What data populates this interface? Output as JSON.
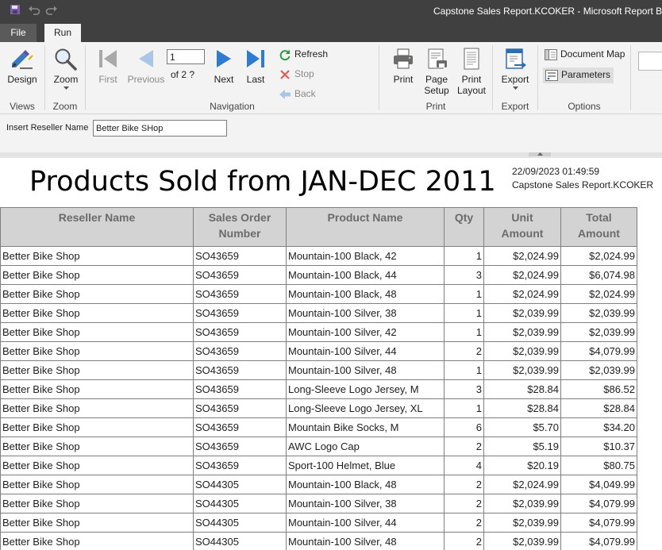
{
  "window": {
    "title": "Capstone Sales Report.KCOKER - Microsoft Report Builde"
  },
  "quick_access": [
    "save-icon",
    "undo-icon",
    "redo-icon"
  ],
  "tabs": {
    "file": "File",
    "run": "Run"
  },
  "ribbon": {
    "views": {
      "label": "Views",
      "design": "Design"
    },
    "zoom": {
      "label": "Zoom",
      "zoom": "Zoom"
    },
    "navigation": {
      "label": "Navigation",
      "first": "First",
      "previous": "Previous",
      "next": "Next",
      "last": "Last",
      "page_current": "1",
      "page_of": "of  2 ?",
      "refresh": "Refresh",
      "stop": "Stop",
      "back": "Back"
    },
    "print": {
      "label": "Print",
      "print": "Print",
      "page_setup_1": "Page",
      "page_setup_2": "Setup",
      "print_layout_1": "Print",
      "print_layout_2": "Layout"
    },
    "export": {
      "label": "Export",
      "export": "Export"
    },
    "options": {
      "label": "Options",
      "document_map": "Document Map",
      "parameters": "Parameters"
    }
  },
  "parameter": {
    "label": "Insert Reseller Name",
    "value": "Better Bike SHop"
  },
  "report": {
    "title": "Products Sold from JAN-DEC 2011",
    "run_date": "22/09/2023 01:49:59",
    "report_name": "Capstone Sales Report.KCOKER",
    "columns": [
      {
        "l1": "Reseller Name",
        "l2": ""
      },
      {
        "l1": "Sales Order",
        "l2": "Number"
      },
      {
        "l1": "Product Name",
        "l2": ""
      },
      {
        "l1": "Qty",
        "l2": ""
      },
      {
        "l1": "Unit",
        "l2": "Amount"
      },
      {
        "l1": "Total",
        "l2": "Amount"
      }
    ],
    "rows": [
      [
        "Better Bike Shop",
        "SO43659",
        "Mountain-100 Black, 42",
        "1",
        "$2,024.99",
        "$2,024.99"
      ],
      [
        "Better Bike Shop",
        "SO43659",
        "Mountain-100 Black, 44",
        "3",
        "$2,024.99",
        "$6,074.98"
      ],
      [
        "Better Bike Shop",
        "SO43659",
        "Mountain-100 Black, 48",
        "1",
        "$2,024.99",
        "$2,024.99"
      ],
      [
        "Better Bike Shop",
        "SO43659",
        "Mountain-100 Silver, 38",
        "1",
        "$2,039.99",
        "$2,039.99"
      ],
      [
        "Better Bike Shop",
        "SO43659",
        "Mountain-100 Silver, 42",
        "1",
        "$2,039.99",
        "$2,039.99"
      ],
      [
        "Better Bike Shop",
        "SO43659",
        "Mountain-100 Silver, 44",
        "2",
        "$2,039.99",
        "$4,079.99"
      ],
      [
        "Better Bike Shop",
        "SO43659",
        "Mountain-100 Silver, 48",
        "1",
        "$2,039.99",
        "$2,039.99"
      ],
      [
        "Better Bike Shop",
        "SO43659",
        "Long-Sleeve Logo Jersey, M",
        "3",
        "$28.84",
        "$86.52"
      ],
      [
        "Better Bike Shop",
        "SO43659",
        "Long-Sleeve Logo Jersey, XL",
        "1",
        "$28.84",
        "$28.84"
      ],
      [
        "Better Bike Shop",
        "SO43659",
        "Mountain Bike Socks, M",
        "6",
        "$5.70",
        "$34.20"
      ],
      [
        "Better Bike Shop",
        "SO43659",
        "AWC Logo Cap",
        "2",
        "$5.19",
        "$10.37"
      ],
      [
        "Better Bike Shop",
        "SO43659",
        "Sport-100 Helmet, Blue",
        "4",
        "$20.19",
        "$80.75"
      ],
      [
        "Better Bike Shop",
        "SO44305",
        "Mountain-100 Black, 48",
        "2",
        "$2,024.99",
        "$4,049.99"
      ],
      [
        "Better Bike Shop",
        "SO44305",
        "Mountain-100 Silver, 38",
        "2",
        "$2,039.99",
        "$4,079.99"
      ],
      [
        "Better Bike Shop",
        "SO44305",
        "Mountain-100 Silver, 44",
        "2",
        "$2,039.99",
        "$4,079.99"
      ],
      [
        "Better Bike Shop",
        "SO44305",
        "Mountain-100 Silver, 48",
        "2",
        "$2,039.99",
        "$4,079.99"
      ]
    ]
  }
}
